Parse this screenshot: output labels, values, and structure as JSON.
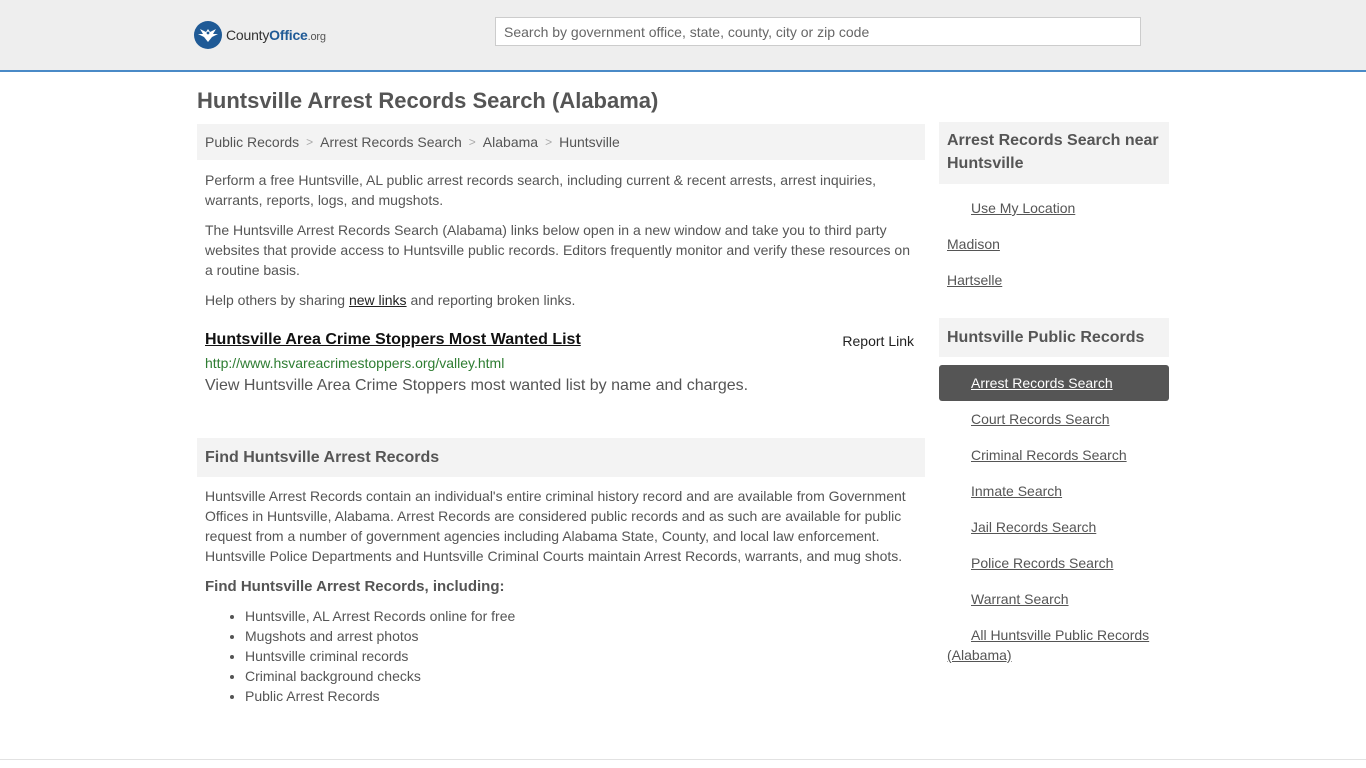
{
  "header": {
    "logo_county": "County",
    "logo_office": "Office",
    "logo_tld": ".org",
    "search_placeholder": "Search by government office, state, county, city or zip code"
  },
  "page_title": "Huntsville Arrest Records Search (Alabama)",
  "breadcrumb": [
    "Public Records",
    "Arrest Records Search",
    "Alabama",
    "Huntsville"
  ],
  "intro": {
    "p1": "Perform a free Huntsville, AL public arrest records search, including current & recent arrests, arrest inquiries, warrants, reports, logs, and mugshots.",
    "p2": "The Huntsville Arrest Records Search (Alabama) links below open in a new window and take you to third party websites that provide access to Huntsville public records. Editors frequently monitor and verify these resources on a routine basis.",
    "p3_before": "Help others by sharing ",
    "p3_link": "new links",
    "p3_after": " and reporting broken links."
  },
  "listing": {
    "title": "Huntsville Area Crime Stoppers Most Wanted List",
    "report": "Report Link",
    "url": "http://www.hsvareacrimestoppers.org/valley.html",
    "description": "View Huntsville Area Crime Stoppers most wanted list by name and charges."
  },
  "find_section": {
    "heading": "Find Huntsville Arrest Records",
    "body": "Huntsville Arrest Records contain an individual's entire criminal history record and are available from Government Offices in Huntsville, Alabama. Arrest Records are considered public records and as such are available for public request from a number of government agencies including Alabama State, County, and local law enforcement. Huntsville Police Departments and Huntsville Criminal Courts maintain Arrest Records, warrants, and mug shots.",
    "subheading": "Find Huntsville Arrest Records, including:",
    "items": [
      "Huntsville, AL Arrest Records online for free",
      "Mugshots and arrest photos",
      "Huntsville criminal records",
      "Criminal background checks",
      "Public Arrest Records"
    ]
  },
  "sidebar": {
    "near_heading": "Arrest Records Search near Huntsville",
    "use_location": "Use My Location",
    "near_items": [
      "Madison",
      "Hartselle"
    ],
    "records_heading": "Huntsville Public Records",
    "records_items": [
      "Arrest Records Search",
      "Court Records Search",
      "Criminal Records Search",
      "Inmate Search",
      "Jail Records Search",
      "Police Records Search",
      "Warrant Search"
    ],
    "all_records": "All Huntsville Public Records (Alabama)"
  },
  "colors": {
    "accent": "#4a8ac7",
    "brand": "#1f5a96",
    "url_green": "#2e7d32",
    "active_bg": "#555555"
  }
}
